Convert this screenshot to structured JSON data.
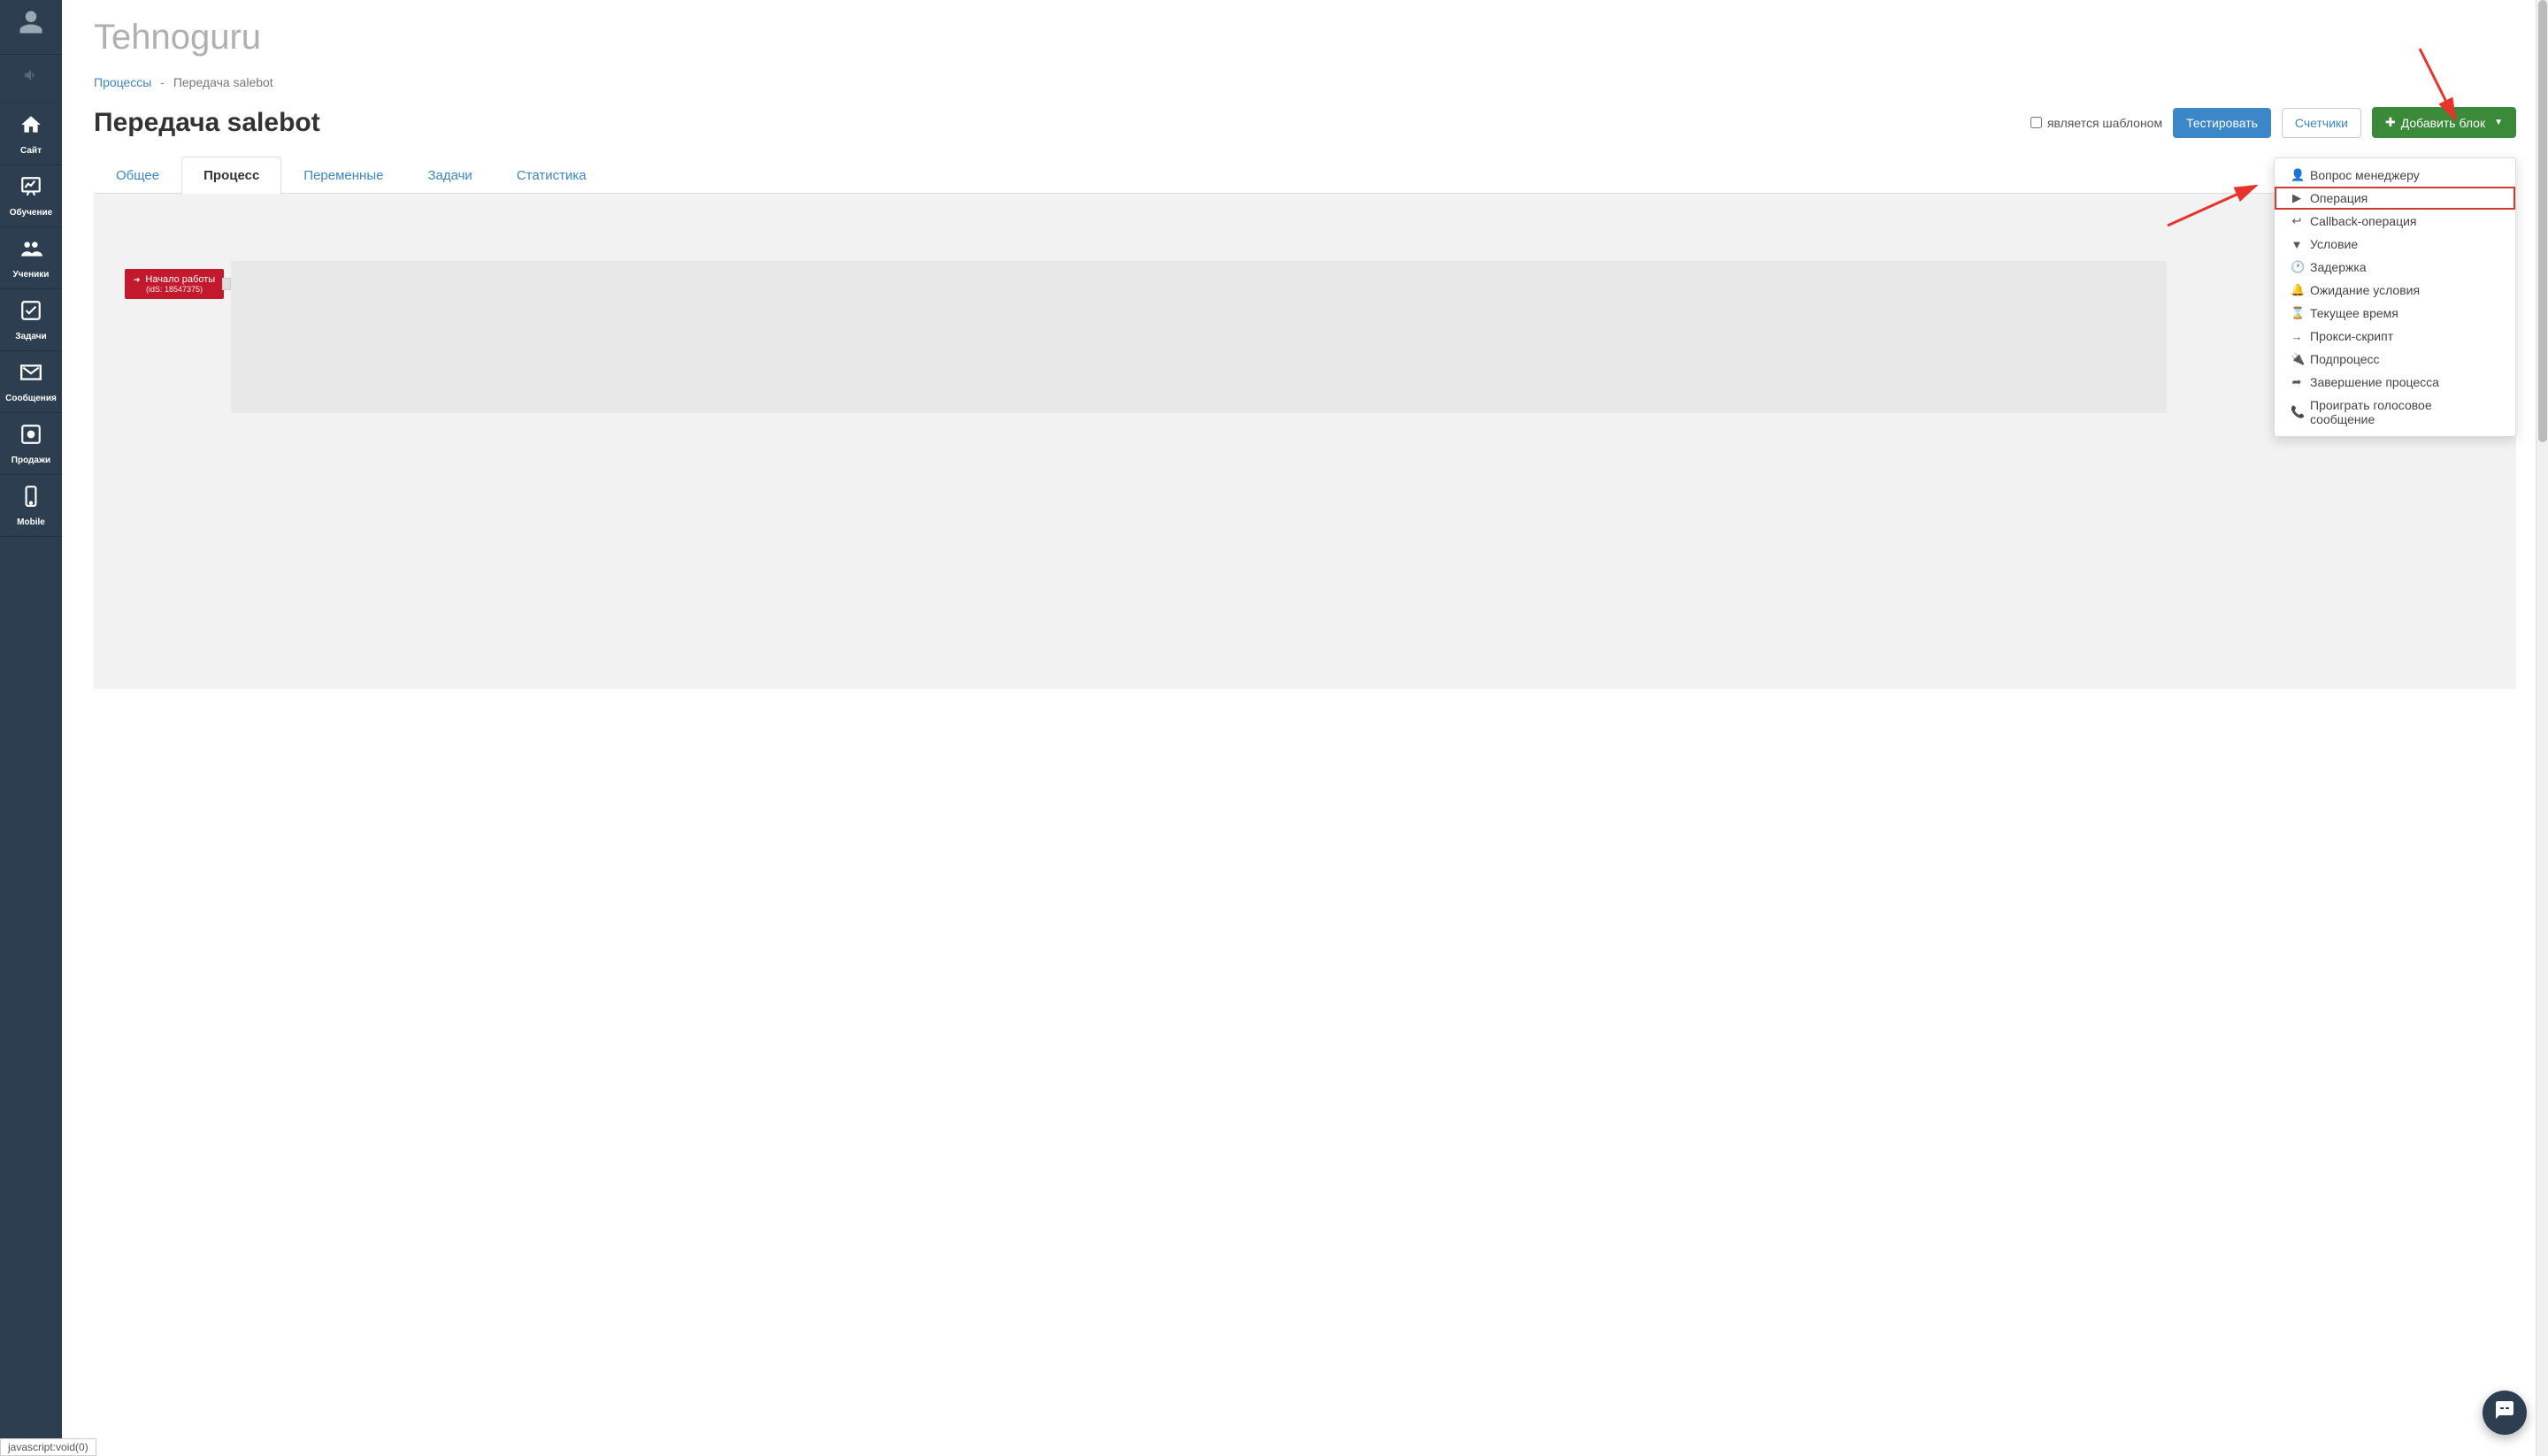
{
  "sidebar": {
    "items": [
      {
        "icon": "user-silhouette",
        "label": ""
      },
      {
        "icon": "speaker-muted",
        "label": ""
      },
      {
        "icon": "house",
        "label": "Сайт"
      },
      {
        "icon": "chart-board",
        "label": "Обучение"
      },
      {
        "icon": "people",
        "label": "Ученики"
      },
      {
        "icon": "check-box",
        "label": "Задачи"
      },
      {
        "icon": "envelope",
        "label": "Сообщения"
      },
      {
        "icon": "safe",
        "label": "Продажи"
      },
      {
        "icon": "phone",
        "label": "Mobile"
      }
    ]
  },
  "app_title": "Tehnoguru",
  "breadcrumb": {
    "root": "Процессы",
    "current": "Передача salebot"
  },
  "page_title": "Передача salebot",
  "header": {
    "checkbox_label": "является шаблоном",
    "test_button": "Тестировать",
    "counters_button": "Счетчики",
    "add_block_button": "Добавить блок"
  },
  "tabs": [
    {
      "label": "Общее",
      "active": false
    },
    {
      "label": "Процесс",
      "active": true
    },
    {
      "label": "Переменные",
      "active": false
    },
    {
      "label": "Задачи",
      "active": false
    },
    {
      "label": "Статистика",
      "active": false
    }
  ],
  "process_node": {
    "title": "Начало работы",
    "sub": "(idS: 18547375)"
  },
  "dropdown": {
    "items": [
      {
        "icon": "user",
        "label": "Вопрос менеджеру",
        "highlighted": false
      },
      {
        "icon": "play",
        "label": "Операция",
        "highlighted": true
      },
      {
        "icon": "reply",
        "label": "Callback-операция",
        "highlighted": false
      },
      {
        "icon": "filter",
        "label": "Условие",
        "highlighted": false
      },
      {
        "icon": "clock",
        "label": "Задержка",
        "highlighted": false
      },
      {
        "icon": "bell",
        "label": "Ожидание условия",
        "highlighted": false
      },
      {
        "icon": "hourglass",
        "label": "Текущее время",
        "highlighted": false
      },
      {
        "icon": "arrow-right",
        "label": "Прокси-скрипт",
        "highlighted": false
      },
      {
        "icon": "plug",
        "label": "Подпроцесс",
        "highlighted": false
      },
      {
        "icon": "sign-out",
        "label": "Завершение процесса",
        "highlighted": false
      },
      {
        "icon": "phone",
        "label": "Проиграть голосовое сообщение",
        "highlighted": false
      }
    ]
  },
  "status_bar": "javascript:void(0)"
}
